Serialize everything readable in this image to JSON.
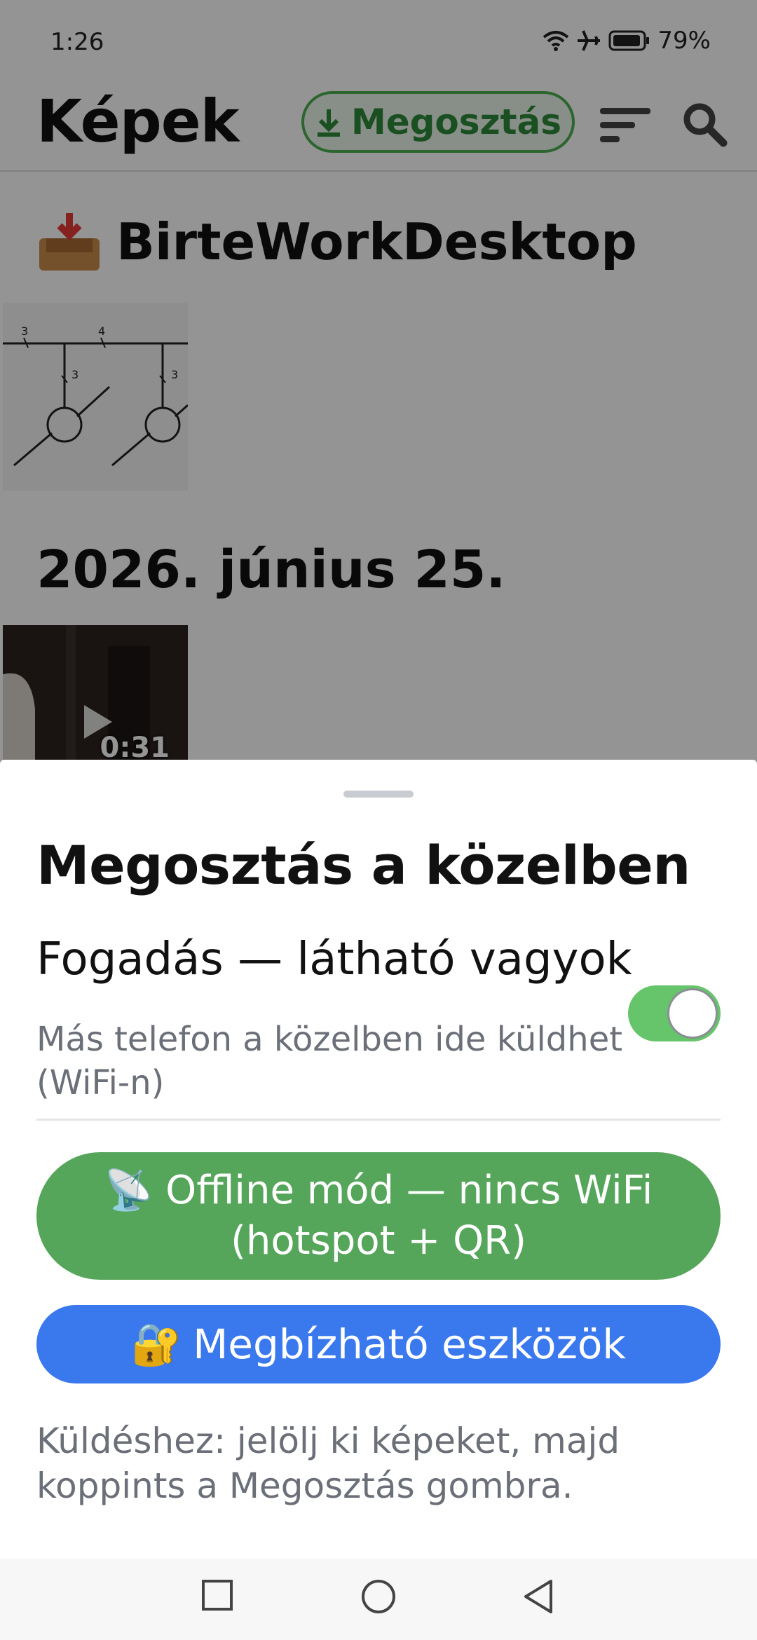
{
  "status_bar": {
    "time": "1:26",
    "battery": "79%"
  },
  "app_bar": {
    "title": "Képek",
    "share_button": "Megosztás"
  },
  "gallery": {
    "album_title": "BirteWorkDesktop",
    "date_header": "2026. június 25.",
    "video_duration": "0:31",
    "diagram_labels": [
      "3",
      "4",
      "3",
      "3"
    ]
  },
  "sheet": {
    "title": "Megosztás a közelben",
    "receive_label": "Fogadás — látható vagyok",
    "receive_desc": "Más telefon a közelben ide küldhet (WiFi-n)",
    "receive_enabled": true,
    "offline_button_line1": "📡 Offline mód — nincs WiFi",
    "offline_button_line2": "(hotspot + QR)",
    "trusted_button": "Megbízható eszközök",
    "trusted_icon": "🔐",
    "hint": "Küldéshez: jelölj ki képeket, majd koppints a Megosztás gombra."
  },
  "colors": {
    "green": "#55a55a",
    "blue": "#3a78ee",
    "toggle_on": "#66c46b"
  }
}
